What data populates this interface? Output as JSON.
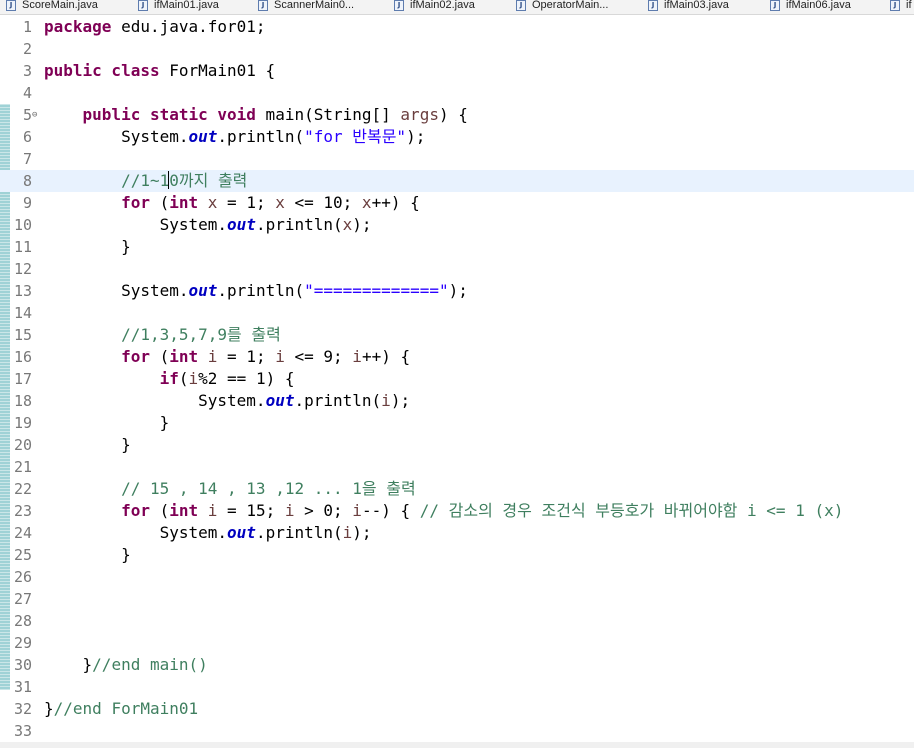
{
  "tabs": [
    {
      "label": "ScoreMain.java"
    },
    {
      "label": "ifMain01.java"
    },
    {
      "label": "ScannerMain0..."
    },
    {
      "label": "ifMain02.java"
    },
    {
      "label": "OperatorMain..."
    },
    {
      "label": "ifMain03.java"
    },
    {
      "label": "ifMain06.java"
    },
    {
      "label": "if"
    }
  ],
  "editor": {
    "fold_marker": "⊖",
    "lines": [
      {
        "n": "1",
        "t": [
          {
            "k": "kw",
            "v": "package"
          },
          {
            "k": "",
            "v": " edu.java.for01;"
          }
        ]
      },
      {
        "n": "2",
        "t": []
      },
      {
        "n": "3",
        "t": [
          {
            "k": "kw",
            "v": "public class"
          },
          {
            "k": "",
            "v": " ForMain01 {"
          }
        ]
      },
      {
        "n": "4",
        "t": []
      },
      {
        "n": "5",
        "fold": true,
        "t": [
          {
            "k": "",
            "v": "    "
          },
          {
            "k": "kw",
            "v": "public static void"
          },
          {
            "k": "",
            "v": " main(String[] "
          },
          {
            "k": "var",
            "v": "args"
          },
          {
            "k": "",
            "v": ") {"
          }
        ]
      },
      {
        "n": "6",
        "t": [
          {
            "k": "",
            "v": "        System."
          },
          {
            "k": "fld",
            "v": "out"
          },
          {
            "k": "",
            "v": ".println("
          },
          {
            "k": "str",
            "v": "\"for 반복문\""
          },
          {
            "k": "",
            "v": ");"
          }
        ]
      },
      {
        "n": "7",
        "t": []
      },
      {
        "n": "8",
        "current": true,
        "t": [
          {
            "k": "",
            "v": "        "
          },
          {
            "k": "cmt",
            "v": "//1~1"
          },
          {
            "k": "caret",
            "v": ""
          },
          {
            "k": "cmt",
            "v": "0까지 출력"
          }
        ]
      },
      {
        "n": "9",
        "t": [
          {
            "k": "",
            "v": "        "
          },
          {
            "k": "kw",
            "v": "for"
          },
          {
            "k": "",
            "v": " ("
          },
          {
            "k": "kw",
            "v": "int"
          },
          {
            "k": "",
            "v": " "
          },
          {
            "k": "var",
            "v": "x"
          },
          {
            "k": "",
            "v": " = 1; "
          },
          {
            "k": "var",
            "v": "x"
          },
          {
            "k": "",
            "v": " <= 10; "
          },
          {
            "k": "var",
            "v": "x"
          },
          {
            "k": "",
            "v": "++) {"
          }
        ]
      },
      {
        "n": "10",
        "t": [
          {
            "k": "",
            "v": "            System."
          },
          {
            "k": "fld",
            "v": "out"
          },
          {
            "k": "",
            "v": ".println("
          },
          {
            "k": "var",
            "v": "x"
          },
          {
            "k": "",
            "v": ");"
          }
        ]
      },
      {
        "n": "11",
        "t": [
          {
            "k": "",
            "v": "        }"
          }
        ]
      },
      {
        "n": "12",
        "t": []
      },
      {
        "n": "13",
        "t": [
          {
            "k": "",
            "v": "        System."
          },
          {
            "k": "fld",
            "v": "out"
          },
          {
            "k": "",
            "v": ".println("
          },
          {
            "k": "str",
            "v": "\"=============\""
          },
          {
            "k": "",
            "v": ");"
          }
        ]
      },
      {
        "n": "14",
        "t": []
      },
      {
        "n": "15",
        "t": [
          {
            "k": "",
            "v": "        "
          },
          {
            "k": "cmt",
            "v": "//1,3,5,7,9를 출력"
          }
        ]
      },
      {
        "n": "16",
        "t": [
          {
            "k": "",
            "v": "        "
          },
          {
            "k": "kw",
            "v": "for"
          },
          {
            "k": "",
            "v": " ("
          },
          {
            "k": "kw",
            "v": "int"
          },
          {
            "k": "",
            "v": " "
          },
          {
            "k": "var",
            "v": "i"
          },
          {
            "k": "",
            "v": " = 1; "
          },
          {
            "k": "var",
            "v": "i"
          },
          {
            "k": "",
            "v": " <= 9; "
          },
          {
            "k": "var",
            "v": "i"
          },
          {
            "k": "",
            "v": "++) {"
          }
        ]
      },
      {
        "n": "17",
        "t": [
          {
            "k": "",
            "v": "            "
          },
          {
            "k": "kw",
            "v": "if"
          },
          {
            "k": "",
            "v": "("
          },
          {
            "k": "var",
            "v": "i"
          },
          {
            "k": "",
            "v": "%2 == 1) {"
          }
        ]
      },
      {
        "n": "18",
        "t": [
          {
            "k": "",
            "v": "                System."
          },
          {
            "k": "fld",
            "v": "out"
          },
          {
            "k": "",
            "v": ".println("
          },
          {
            "k": "var",
            "v": "i"
          },
          {
            "k": "",
            "v": ");"
          }
        ]
      },
      {
        "n": "19",
        "t": [
          {
            "k": "",
            "v": "            }"
          }
        ]
      },
      {
        "n": "20",
        "t": [
          {
            "k": "",
            "v": "        }"
          }
        ]
      },
      {
        "n": "21",
        "t": []
      },
      {
        "n": "22",
        "t": [
          {
            "k": "",
            "v": "        "
          },
          {
            "k": "cmt",
            "v": "// 15 , 14 , 13 ,12 ... 1을 출력"
          }
        ]
      },
      {
        "n": "23",
        "t": [
          {
            "k": "",
            "v": "        "
          },
          {
            "k": "kw",
            "v": "for"
          },
          {
            "k": "",
            "v": " ("
          },
          {
            "k": "kw",
            "v": "int"
          },
          {
            "k": "",
            "v": " "
          },
          {
            "k": "var",
            "v": "i"
          },
          {
            "k": "",
            "v": " = 15; "
          },
          {
            "k": "var",
            "v": "i"
          },
          {
            "k": "",
            "v": " > 0; "
          },
          {
            "k": "var",
            "v": "i"
          },
          {
            "k": "",
            "v": "--) { "
          },
          {
            "k": "cmt",
            "v": "// 감소의 경우 조건식 부등호가 바뀌어야함 i <= 1 (x)"
          }
        ]
      },
      {
        "n": "24",
        "t": [
          {
            "k": "",
            "v": "            System."
          },
          {
            "k": "fld",
            "v": "out"
          },
          {
            "k": "",
            "v": ".println("
          },
          {
            "k": "var",
            "v": "i"
          },
          {
            "k": "",
            "v": ");"
          }
        ]
      },
      {
        "n": "25",
        "t": [
          {
            "k": "",
            "v": "        }"
          }
        ]
      },
      {
        "n": "26",
        "t": []
      },
      {
        "n": "27",
        "t": []
      },
      {
        "n": "28",
        "t": []
      },
      {
        "n": "29",
        "t": []
      },
      {
        "n": "30",
        "t": [
          {
            "k": "",
            "v": "    }"
          },
          {
            "k": "cmt",
            "v": "//end main()"
          }
        ]
      },
      {
        "n": "31",
        "t": []
      },
      {
        "n": "32",
        "t": [
          {
            "k": "",
            "v": "}"
          },
          {
            "k": "cmt",
            "v": "//end ForMain01"
          }
        ]
      },
      {
        "n": "33",
        "t": []
      }
    ]
  }
}
